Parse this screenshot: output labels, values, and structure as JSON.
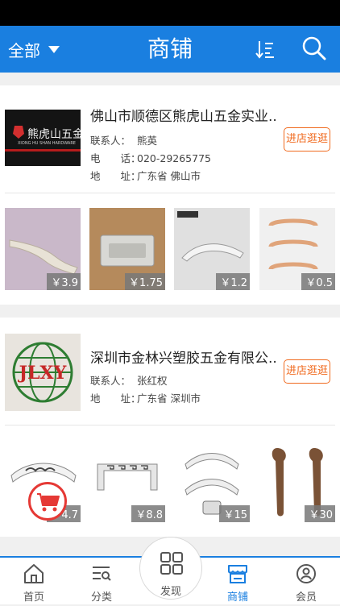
{
  "header": {
    "filter_label": "全部",
    "title": "商铺",
    "sort_icon": "sort-icon",
    "search_icon": "search-icon"
  },
  "shops": [
    {
      "name": "佛山市顺德区熊虎山五金实业...",
      "logo_text": "熊虎山五金",
      "logo_subtext": "XIONG HU SHAN HARDWARE",
      "contact_label": "联系人：",
      "contact": "熊英",
      "phone_label": "电　　话：",
      "phone": "020-29265775",
      "address_label": "地　　址：",
      "address": "广东省 佛山市",
      "visit_label": "进店逛逛",
      "products": [
        {
          "price": "￥3.9"
        },
        {
          "price": "￥1.75"
        },
        {
          "price": "￥1.2"
        },
        {
          "price": "￥0.5"
        }
      ]
    },
    {
      "name": "深圳市金林兴塑胶五金有限公...",
      "logo_text": "JLXY",
      "contact_label": "联系人：",
      "contact": "张红权",
      "address_label": "地　　址：",
      "address": "广东省 深圳市",
      "visit_label": "进店逛逛",
      "products": [
        {
          "price": "￥4.7"
        },
        {
          "price": "￥8.8"
        },
        {
          "price": "￥15"
        },
        {
          "price": "￥30"
        }
      ]
    }
  ],
  "tabs": [
    {
      "label": "首页",
      "icon": "home-icon"
    },
    {
      "label": "分类",
      "icon": "category-icon"
    },
    {
      "label": "发现",
      "icon": "discover-icon"
    },
    {
      "label": "商铺",
      "icon": "shop-icon"
    },
    {
      "label": "会员",
      "icon": "member-icon"
    }
  ],
  "colors": {
    "primary": "#1a7fe0",
    "accent": "#f06a1e",
    "cart": "#e53935"
  }
}
